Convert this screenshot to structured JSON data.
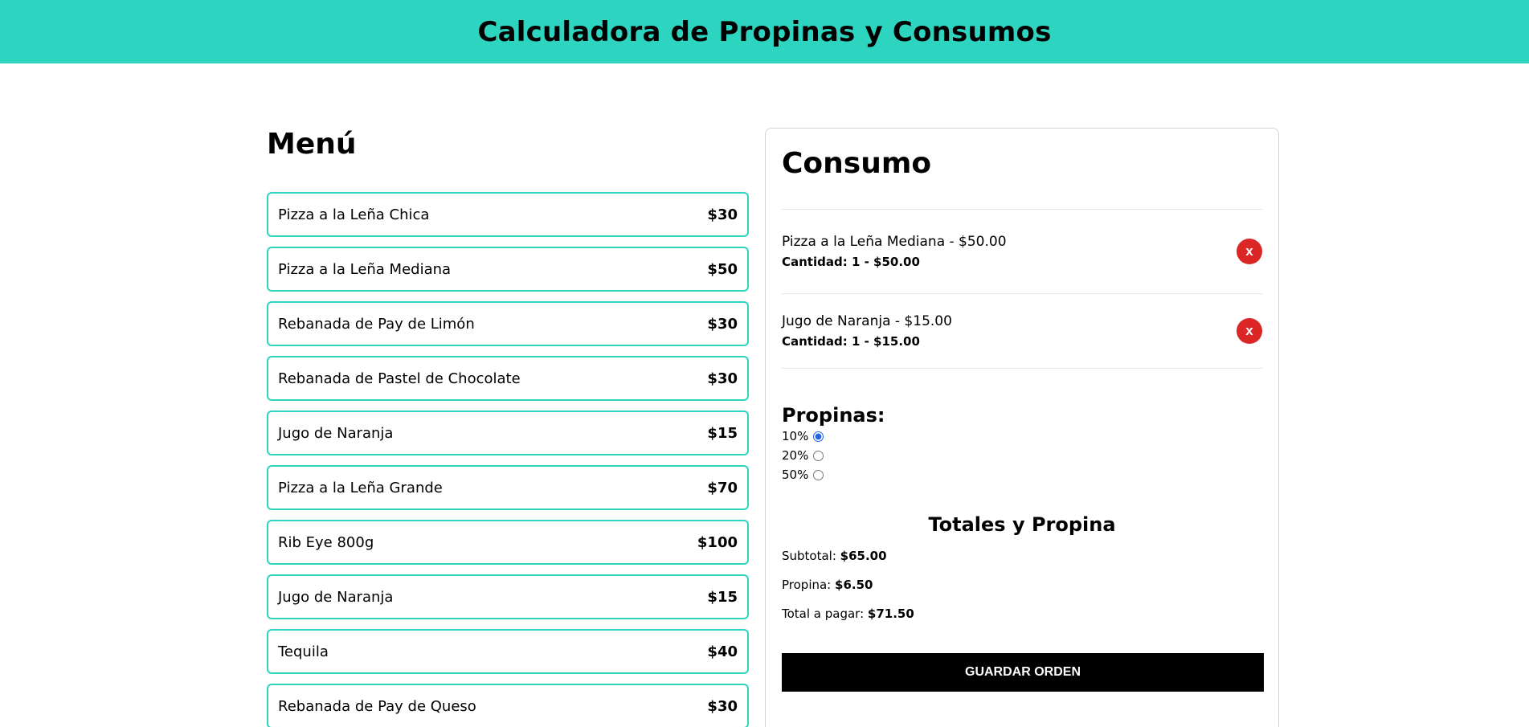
{
  "header": {
    "title": "Calculadora de Propinas y Consumos"
  },
  "menu": {
    "title": "Menú",
    "items": [
      {
        "name": "Pizza a la Leña Chica",
        "price": "$30"
      },
      {
        "name": "Pizza a la Leña Mediana",
        "price": "$50"
      },
      {
        "name": "Rebanada de Pay de Limón",
        "price": "$30"
      },
      {
        "name": "Rebanada de Pastel de Chocolate",
        "price": "$30"
      },
      {
        "name": "Jugo de Naranja",
        "price": "$15"
      },
      {
        "name": "Pizza a la Leña Grande",
        "price": "$70"
      },
      {
        "name": "Rib Eye 800g",
        "price": "$100"
      },
      {
        "name": "Jugo de Naranja",
        "price": "$15"
      },
      {
        "name": "Tequila",
        "price": "$40"
      },
      {
        "name": "Rebanada de Pay de Queso",
        "price": "$30"
      }
    ]
  },
  "consumo": {
    "title": "Consumo",
    "orders": [
      {
        "name_price": "Pizza a la Leña Mediana - $50.00",
        "qty": "Cantidad: 1 - $50.00",
        "remove_label": "x"
      },
      {
        "name_price": "Jugo de Naranja - $15.00",
        "qty": "Cantidad: 1 - $15.00",
        "remove_label": "x"
      }
    ],
    "tips": {
      "title": "Propinas:",
      "options": [
        "10%",
        "20%",
        "50%"
      ],
      "selected": "10%"
    },
    "totals": {
      "title": "Totales y Propina",
      "subtotal_label": "Subtotal:",
      "subtotal_value": "$65.00",
      "tip_label": "Propina:",
      "tip_value": "$6.50",
      "total_label": "Total a pagar:",
      "total_value": "$71.50"
    },
    "save_label": "GUARDAR ORDEN"
  }
}
